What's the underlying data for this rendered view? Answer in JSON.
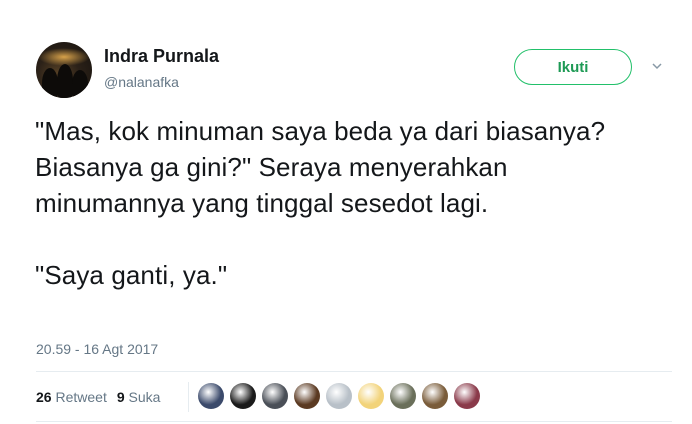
{
  "author": {
    "name": "Indra Purnala",
    "handle": "@nalanafka",
    "avatar_icon": "profile-photo"
  },
  "actions": {
    "follow_label": "Ikuti",
    "more_icon": "chevron-down-icon"
  },
  "tweet": {
    "paragraph_1": "\"Mas, kok minuman saya beda ya dari biasanya? Biasanya ga gini?\" Seraya menyerahkan minumannya yang tinggal sesedot lagi.",
    "paragraph_2": "\"Saya ganti, ya.\"",
    "timestamp": "20.59 - 16 Agt 2017"
  },
  "stats": {
    "retweet_count": "26",
    "retweet_label": "Retweet",
    "like_count": "9",
    "like_label": "Suka"
  },
  "likers": [
    {
      "color": "#3b4a6b"
    },
    {
      "color": "#1b1b1b"
    },
    {
      "color": "#4a4f57"
    },
    {
      "color": "#5b3a22"
    },
    {
      "color": "#b8c0c8"
    },
    {
      "color": "#f2d37a"
    },
    {
      "color": "#6a6f5a"
    },
    {
      "color": "#7a5c3a"
    },
    {
      "color": "#8a3a4a"
    }
  ],
  "colors": {
    "follow_accent": "#22c06a",
    "secondary_text": "#657786",
    "primary_text": "#14171a"
  }
}
